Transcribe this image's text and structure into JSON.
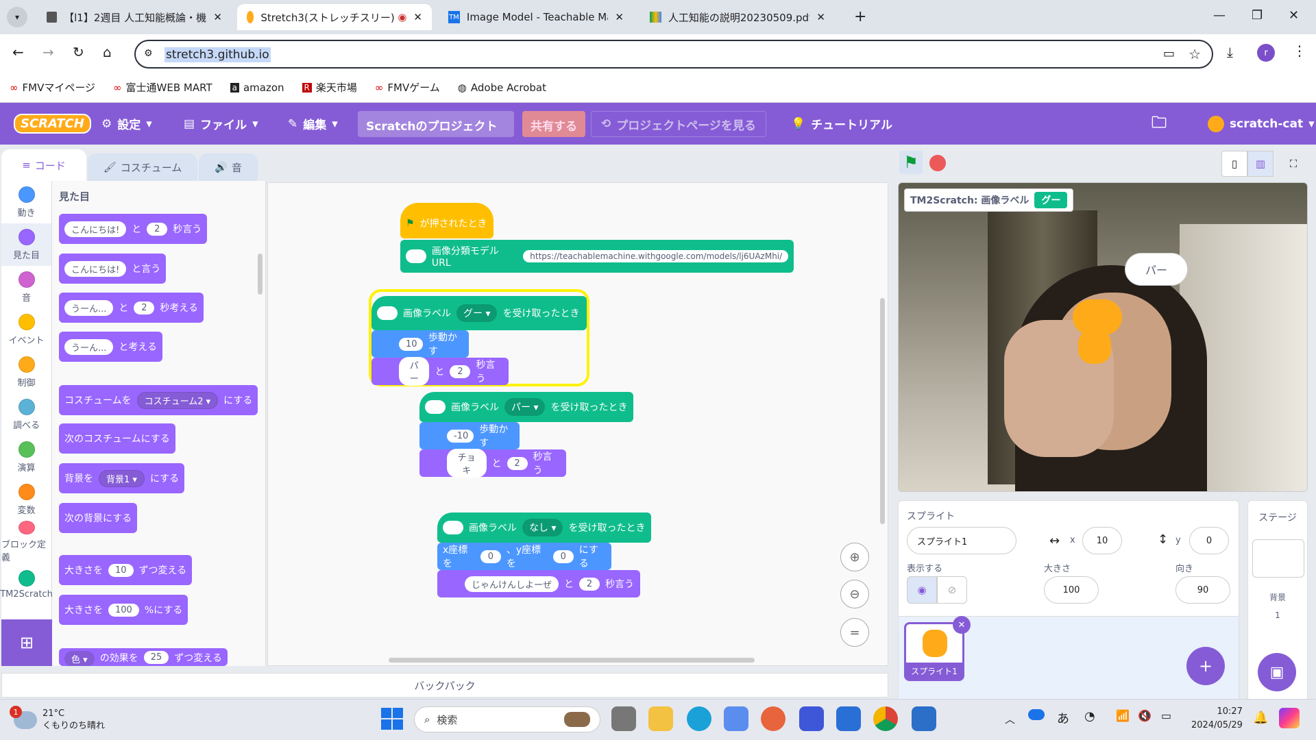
{
  "browser": {
    "tabs": [
      {
        "label": "【l1】2週目 人工知能概論・機械学",
        "icon": "doc-icon",
        "active": false
      },
      {
        "label": "Stretch3(ストレッチスリー)",
        "icon": "scratch-cat-icon",
        "active": true
      },
      {
        "label": "Image Model - Teachable Mach",
        "icon": "tm-icon",
        "active": false
      },
      {
        "label": "人工知能の説明20230509.pdf -",
        "icon": "drive-icon",
        "active": false
      }
    ],
    "url": "stretch3.github.io",
    "profile_initial": "r",
    "bookmarks": [
      "FMVマイページ",
      "富士通WEB MART",
      "amazon",
      "楽天市場",
      "FMVゲーム",
      "Adobe Acrobat"
    ]
  },
  "menu": {
    "logo": "SCRATCH",
    "settings": "設定",
    "file": "ファイル",
    "edit": "編集",
    "project_title": "Scratchのプロジェクト",
    "share": "共有する",
    "see_project": "プロジェクトページを見る",
    "tutorials": "チュートリアル",
    "username": "scratch-cat"
  },
  "editor_tabs": {
    "code": "コード",
    "costumes": "コスチューム",
    "sounds": "音"
  },
  "categories": [
    {
      "label": "動き",
      "color": "#4c97ff"
    },
    {
      "label": "見た目",
      "color": "#9966ff"
    },
    {
      "label": "音",
      "color": "#cf63cf"
    },
    {
      "label": "イベント",
      "color": "#ffbf00"
    },
    {
      "label": "制御",
      "color": "#ffab19"
    },
    {
      "label": "調べる",
      "color": "#5cb1d6"
    },
    {
      "label": "演算",
      "color": "#59c059"
    },
    {
      "label": "変数",
      "color": "#ff8c1a"
    },
    {
      "label": "ブロック定義",
      "color": "#ff6680"
    },
    {
      "label": "TM2Scratch",
      "color": "#0fbd8c"
    }
  ],
  "palette": {
    "heading": "見た目",
    "b1": {
      "text": "こんにちは!",
      "mid": "と",
      "num": "2",
      "end": "秒言う"
    },
    "b2": {
      "text": "こんにちは!",
      "end": "と言う"
    },
    "b3": {
      "text": "うーん...",
      "mid": "と",
      "num": "2",
      "end": "秒考える"
    },
    "b4": {
      "text": "うーん...",
      "end": "と考える"
    },
    "b5": {
      "start": "コスチュームを",
      "dd": "コスチューム2",
      "end": "にする"
    },
    "b6": "次のコスチュームにする",
    "b7": {
      "start": "背景を",
      "dd": "背景1",
      "end": "にする"
    },
    "b8": "次の背景にする",
    "b9": {
      "start": "大きさを",
      "num": "10",
      "end": "ずつ変える"
    },
    "b10": {
      "start": "大きさを",
      "num": "100",
      "end": "%にする"
    },
    "b11": {
      "dd": "色",
      "mid": "の効果を",
      "num": "25",
      "end": "ずつ変える"
    }
  },
  "scripts": {
    "s1": {
      "hat": "が押されたとき",
      "model_label": "画像分類モデルURL",
      "url": "https://teachablemachine.withgoogle.com/models/lj6UAzMhi/"
    },
    "s2": {
      "hat_label": "画像ラベル",
      "dd": "グー",
      "hat_end": "を受け取ったとき",
      "move_num": "10",
      "move": "歩動かす",
      "say": "パー",
      "and": "と",
      "secs": "2",
      "say_end": "秒言う"
    },
    "s3": {
      "hat_label": "画像ラベル",
      "dd": "パー",
      "hat_end": "を受け取ったとき",
      "move_num": "-10",
      "move": "歩動かす",
      "say": "チョキ",
      "and": "と",
      "secs": "2",
      "say_end": "秒言う"
    },
    "s4": {
      "hat_label": "画像ラベル",
      "dd": "なし",
      "hat_end": "を受け取ったとき",
      "goto_a": "x座標を",
      "x": "0",
      "goto_b": "、y座標を",
      "y": "0",
      "goto_c": "にする",
      "say": "じゃんけんしよーぜ",
      "and": "と",
      "secs": "2",
      "say_end": "秒言う"
    }
  },
  "backpack": "バックパック",
  "stage": {
    "monitor_label": "TM2Scratch: 画像ラベル",
    "monitor_value": "グー",
    "speech": "パー"
  },
  "sprite_info": {
    "title": "スプライト",
    "name": "スプライト1",
    "x_label": "x",
    "x": "10",
    "y_label": "y",
    "y": "0",
    "show_label": "表示する",
    "size_label": "大きさ",
    "size": "100",
    "direction_label": "向き",
    "direction": "90",
    "thumb_label": "スプライト1"
  },
  "stage_panel": {
    "title": "ステージ",
    "backdrops_label": "背景",
    "backdrops_count": "1"
  },
  "taskbar": {
    "weather_temp": "21°C",
    "weather_text": "くもりのち晴れ",
    "weather_badge": "1",
    "search": "検索",
    "ime": "あ",
    "time": "10:27",
    "date": "2024/05/29"
  }
}
